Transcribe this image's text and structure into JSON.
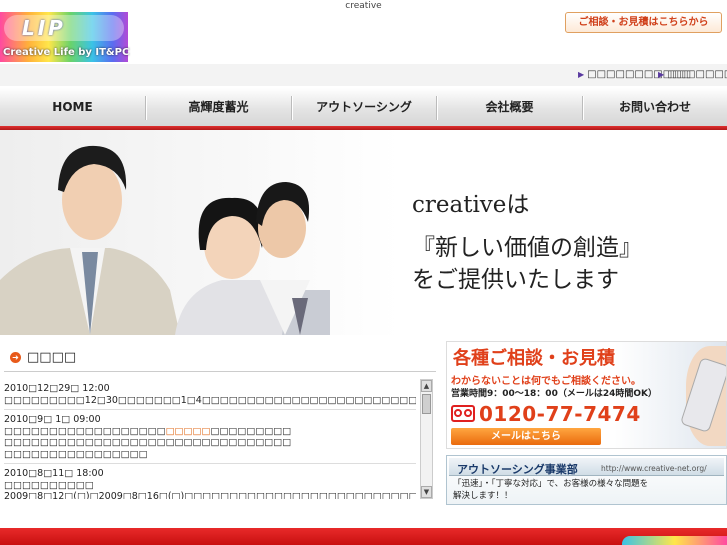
{
  "page": {
    "title": "creative"
  },
  "header": {
    "logo_text": "LIP",
    "logo_sub": "Creative Life by IT&PC",
    "consult_button": "ご相談・お見積はこちらから"
  },
  "subnav": {
    "items": [
      "□□□□□□□□□□□",
      "□□□□□□□"
    ]
  },
  "nav": {
    "items": [
      "HOME",
      "高輝度蓄光",
      "アウトソーシング",
      "会社概要",
      "お問い合わせ"
    ]
  },
  "hero": {
    "lines": [
      "creativeは",
      "『新しい価値の創造』",
      "をご提供いたします"
    ]
  },
  "news": {
    "title": "□□□□",
    "items": [
      {
        "date": "2010□12□29□ 12:00",
        "body": "□□□□□□□□□12□30□□□□□□□1□4□□□□□□□□□□□□□□□□□□□□□□□□□□□□□□□□□□□□□□□□□□□□□"
      },
      {
        "date": "2010□9□ 1□ 09:00",
        "body_pre": "□□□□□□□□□□□□□□□□□□",
        "body_hl": "□□□□□",
        "body_post": "□□□□□□□□□",
        "body2": "□□□□□□□□□□□□□□□□□□□□□□□□□□□□□□□□",
        "body3": "□□□□□□□□□□□□□□□□"
      },
      {
        "date": "2010□8□11□ 18:00",
        "body": "□□□□□□□□□□",
        "body2": "2009□8□12□(□)□2009□8□16□(□)□□□□□□□□□□□□□□□□□□□□□□□□□□□"
      }
    ]
  },
  "banner_consult": {
    "title": "各種ご相談・お見積",
    "line1": "わからないことは何でもご相談ください。",
    "line2": "営業時間9：00～18：00（メールは24時間OK）",
    "phone": "0120-77-7474",
    "mail_button": "メールはこちら"
  },
  "banner_outsourcing": {
    "title": "アウトソーシング事業部",
    "url": "http://www.creative-net.org/",
    "desc1": "「迅速」・「丁寧な対応」で、お客様の様々な問題を",
    "desc2": "解決します！！"
  },
  "colors": {
    "accent_red": "#d81a1a",
    "orange": "#e0401a"
  }
}
